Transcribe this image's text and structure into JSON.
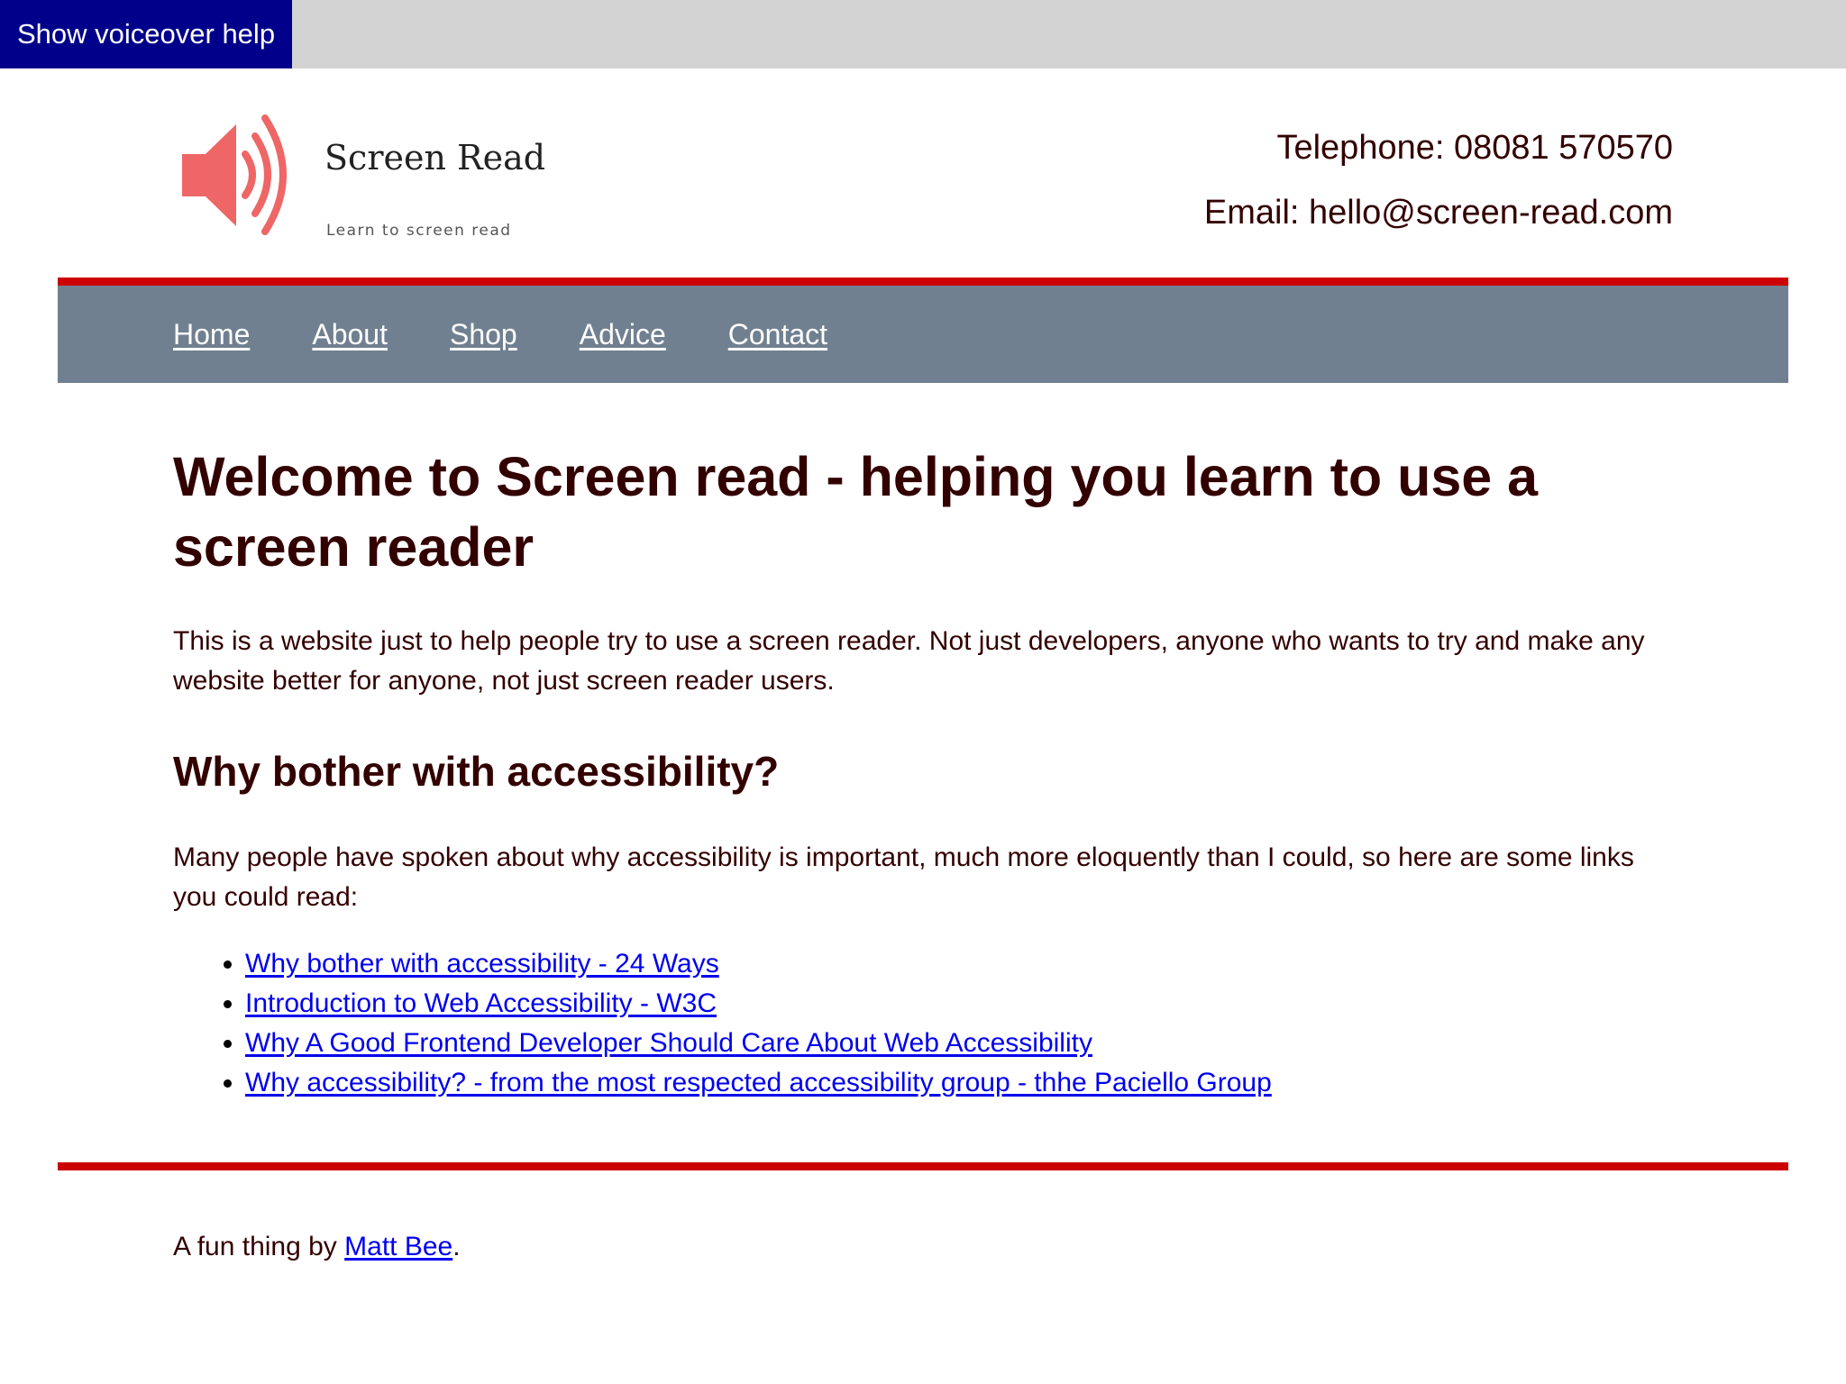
{
  "voiceover": {
    "label": "Show voiceover help"
  },
  "logo": {
    "title": "Screen Read",
    "tagline": "Learn to screen read",
    "icon": "speaker-icon",
    "color": "#ee6666"
  },
  "contact": {
    "telephone": "Telephone: 08081 570570",
    "email": "Email: hello@screen-read.com"
  },
  "nav": {
    "items": [
      {
        "label": "Home"
      },
      {
        "label": "About"
      },
      {
        "label": "Shop"
      },
      {
        "label": "Advice"
      },
      {
        "label": "Contact"
      }
    ]
  },
  "main": {
    "title": "Welcome to Screen read - helping you learn to use a screen reader",
    "intro": "This is a website just to help people try to use a screen reader. Not just developers, anyone who wants to try and make any website better for anyone, not just screen reader users.",
    "section_title": "Why bother with accessibility?",
    "links_intro": "Many people have spoken about why accessibility is important, much more eloquently than I could, so here are some links you could read:",
    "links": [
      {
        "label": "Why bother with accessibility - 24 Ways"
      },
      {
        "label": "Introduction to Web Accessibility - W3C"
      },
      {
        "label": "Why A Good Frontend Developer Should Care About Web Accessibility"
      },
      {
        "label": "Why accessibility? - from the most respected accessibility group - thhe Paciello Group"
      }
    ]
  },
  "footer": {
    "prefix": "A fun thing by ",
    "author": "Matt Bee",
    "suffix": "."
  },
  "colors": {
    "accent_red": "#cc0000",
    "nav_bg": "#708090",
    "voiceover_bg": "#00008b",
    "text": "#330000",
    "link": "#0000ee"
  }
}
